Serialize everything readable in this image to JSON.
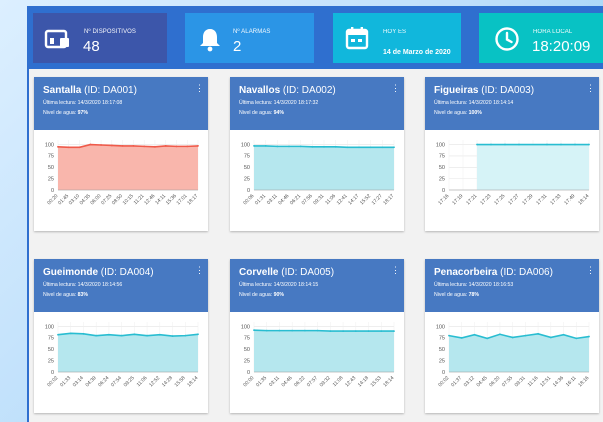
{
  "stats": {
    "devices": {
      "label": "Nº DISPOSITIVOS",
      "value": "48",
      "color": "#3c56aa",
      "icon": "device-icon"
    },
    "alarms": {
      "label": "Nº ALARMAS",
      "value": "2",
      "color": "#2b95e6",
      "icon": "bell-icon"
    },
    "today": {
      "label": "HOY ES",
      "value": "14 de Marzo de 2020",
      "color": "#11b7dc",
      "icon": "calendar-icon"
    },
    "time": {
      "label": "HORA LOCAL",
      "value": "18:20:09",
      "color": "#08c2c4",
      "icon": "clock-icon"
    }
  },
  "labels": {
    "lectura": "Última lectura:",
    "nivel": "Nivel de agua:"
  },
  "devices": [
    {
      "name": "Santalla",
      "id": "(ID: DA001)",
      "lectura": "14/3/2020 18:17:08",
      "nivel": "97%",
      "chart_data": {
        "type": "area",
        "color": "#ef5a4a",
        "fill": "#f9b6ac",
        "x": [
          "00:20",
          "01:45",
          "03:10",
          "04:35",
          "06:00",
          "07:25",
          "08:50",
          "10:15",
          "11:21",
          "12:46",
          "14:11",
          "15:36",
          "17:01",
          "18:17"
        ],
        "y": [
          95,
          94,
          94,
          100,
          99,
          98,
          97,
          97,
          96,
          95,
          97,
          96,
          96,
          97
        ],
        "yticks": [
          0,
          25,
          50,
          75,
          100
        ],
        "ylim": [
          0,
          110
        ],
        "xticks": [
          "00:20",
          "01:45",
          "03:10",
          "04:35",
          "06:00",
          "07:25",
          "08:50",
          "10:15",
          "11:21",
          "12:46",
          "14:11",
          "15:36",
          "17:01",
          "18:17"
        ]
      }
    },
    {
      "name": "Navallos",
      "id": "(ID: DA002)",
      "lectura": "14/3/2020 18:17:32",
      "nivel": "94%",
      "chart_data": {
        "type": "area",
        "color": "#29bdd1",
        "fill": "#b5e7ee",
        "x": [
          "00:06",
          "01:31",
          "03:11",
          "04:46",
          "06:21",
          "07:56",
          "09:31",
          "11:06",
          "12:41",
          "14:17",
          "15:52",
          "17:27",
          "18:17"
        ],
        "y": [
          97,
          97,
          96,
          96,
          96,
          95,
          95,
          95,
          94,
          94,
          94,
          94,
          94
        ],
        "yticks": [
          0,
          25,
          50,
          75,
          100
        ],
        "ylim": [
          0,
          110
        ],
        "xticks": [
          "00:06",
          "01:31",
          "03:11",
          "04:46",
          "06:21",
          "07:56",
          "09:31",
          "11:06",
          "12:41",
          "14:17",
          "15:52",
          "17:27",
          "18:17"
        ]
      }
    },
    {
      "name": "Figueiras",
      "id": "(ID: DA003)",
      "lectura": "14/3/2020 18:14:14",
      "nivel": "100%",
      "chart_data": {
        "type": "area",
        "color": "#29bdd1",
        "fill": "#d6f3f7",
        "x": [
          "17:16",
          "17:19",
          "17:21",
          "17:23",
          "17:25",
          "17:27",
          "17:29",
          "17:31",
          "17:33",
          "17:49",
          "18:14"
        ],
        "y": [
          null,
          null,
          100,
          100,
          100,
          100,
          null,
          100,
          100,
          100,
          100
        ],
        "yticks": [
          0,
          25,
          50,
          75,
          100
        ],
        "ylim": [
          0,
          110
        ],
        "xticks": [
          "17:16",
          "17:19",
          "17:21",
          "17:23",
          "17:25",
          "17:27",
          "17:29",
          "17:31",
          "17:33",
          "17:49",
          "18:14"
        ]
      }
    },
    {
      "name": "Gueimonde",
      "id": "(ID: DA004)",
      "lectura": "14/3/2020 18:14:56",
      "nivel": "83%",
      "chart_data": {
        "type": "area",
        "color": "#29bdd1",
        "fill": "#b5e7ee",
        "x": [
          "00:02",
          "01:33",
          "03:14",
          "04:39",
          "06:24",
          "07:54",
          "09:25",
          "11:06",
          "12:52",
          "14:28",
          "15:58",
          "18:14"
        ],
        "y": [
          82,
          85,
          84,
          80,
          82,
          80,
          83,
          80,
          82,
          79,
          80,
          83
        ],
        "yticks": [
          0,
          25,
          50,
          75,
          100
        ],
        "ylim": [
          0,
          110
        ],
        "xticks": [
          "00:02",
          "01:33",
          "03:14",
          "04:39",
          "06:24",
          "07:54",
          "09:25",
          "11:06",
          "12:52",
          "14:28",
          "15:58",
          "18:14"
        ]
      }
    },
    {
      "name": "Corvelle",
      "id": "(ID: DA005)",
      "lectura": "14/3/2020 18:14:15",
      "nivel": "90%",
      "chart_data": {
        "type": "area",
        "color": "#29bdd1",
        "fill": "#b5e7ee",
        "x": [
          "00:00",
          "01:35",
          "03:11",
          "04:46",
          "06:22",
          "07:57",
          "09:32",
          "11:08",
          "12:43",
          "14:18",
          "15:53",
          "18:14"
        ],
        "y": [
          92,
          91,
          91,
          91,
          91,
          91,
          90,
          90,
          90,
          90,
          90,
          90
        ],
        "yticks": [
          0,
          25,
          50,
          75,
          100
        ],
        "ylim": [
          0,
          110
        ],
        "xticks": [
          "00:00",
          "01:35",
          "03:11",
          "04:46",
          "06:22",
          "07:57",
          "09:32",
          "11:08",
          "12:43",
          "14:18",
          "15:53",
          "18:14"
        ]
      }
    },
    {
      "name": "Penacorbeira",
      "id": "(ID: DA006)",
      "lectura": "14/3/2020 18:16:53",
      "nivel": "78%",
      "chart_data": {
        "type": "area",
        "color": "#29bdd1",
        "fill": "#b5e7ee",
        "x": [
          "00:02",
          "01:37",
          "03:12",
          "04:45",
          "06:20",
          "07:55",
          "09:31",
          "11:16",
          "12:51",
          "14:36",
          "16:11",
          "18:16"
        ],
        "y": [
          80,
          75,
          82,
          74,
          83,
          76,
          80,
          84,
          76,
          82,
          74,
          78
        ],
        "yticks": [
          0,
          25,
          50,
          75,
          100
        ],
        "ylim": [
          0,
          110
        ],
        "xticks": [
          "00:02",
          "01:37",
          "03:12",
          "04:45",
          "06:20",
          "07:55",
          "09:31",
          "11:16",
          "12:51",
          "14:36",
          "16:11",
          "18:16"
        ]
      }
    }
  ]
}
